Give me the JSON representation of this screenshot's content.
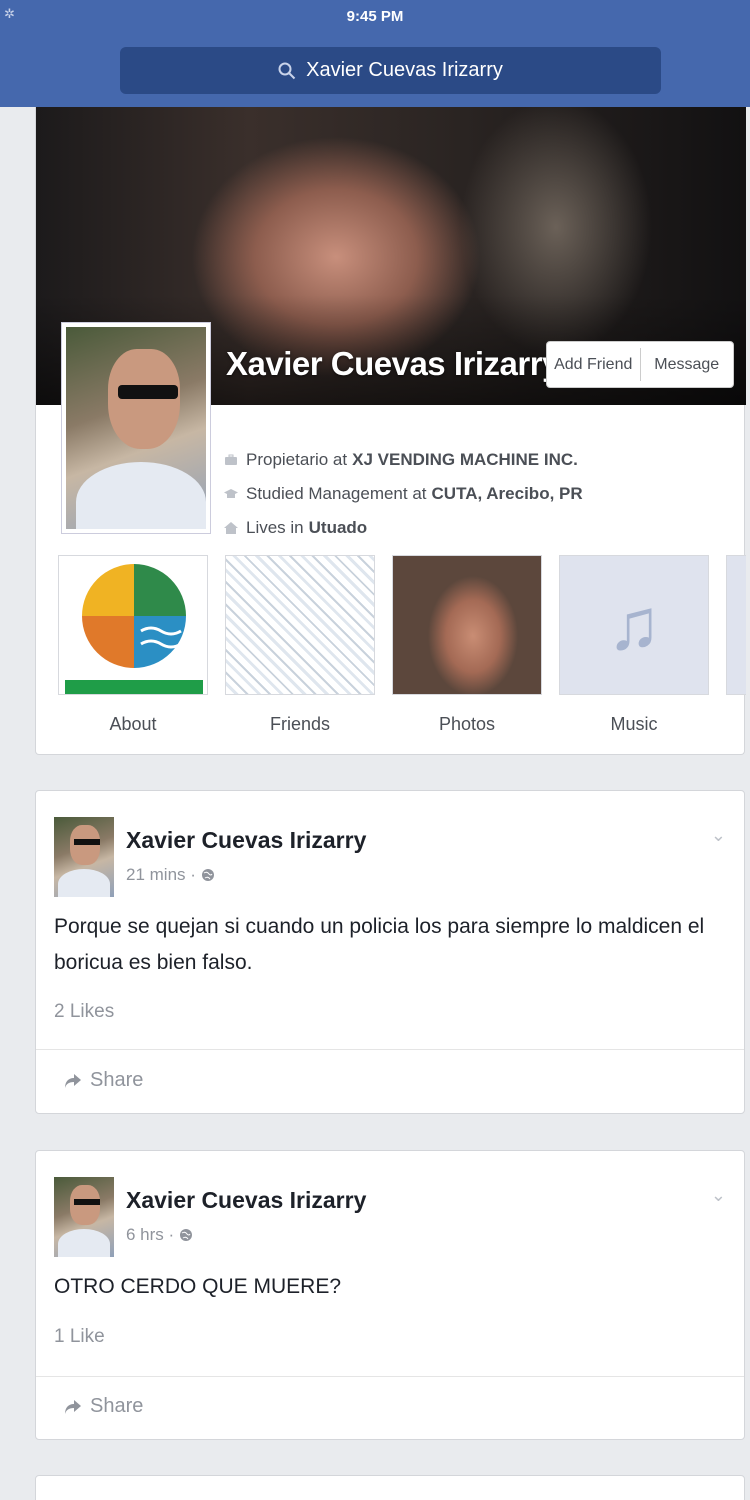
{
  "status_bar": {
    "time": "9:45 PM"
  },
  "search": {
    "query": "Xavier Cuevas Irizarry"
  },
  "profile": {
    "name": "Xavier Cuevas Irizarry",
    "actions": {
      "add_friend": "Add Friend",
      "message": "Message"
    },
    "info": [
      {
        "prefix": "Propietario at",
        "value": "XJ VENDING MACHINE INC.",
        "icon": "briefcase-icon"
      },
      {
        "prefix": "Studied Management at",
        "value": "CUTA, Arecibo, PR",
        "icon": "graduation-cap-icon"
      },
      {
        "prefix": "Lives in",
        "value": "Utuado",
        "icon": "home-icon"
      }
    ],
    "tiles": [
      {
        "label": "About"
      },
      {
        "label": "Friends"
      },
      {
        "label": "Photos"
      },
      {
        "label": "Music"
      }
    ]
  },
  "posts": [
    {
      "author": "Xavier Cuevas Irizarry",
      "time": "21 mins",
      "text": "Porque se quejan si cuando un policia los para siempre lo maldicen el boricua es bien falso.",
      "likes": "2 Likes",
      "share": "Share"
    },
    {
      "author": "Xavier Cuevas Irizarry",
      "time": "6 hrs",
      "text": "OTRO CERDO QUE MUERE?",
      "likes": "1 Like",
      "share": "Share"
    }
  ],
  "colors": {
    "header": "#4568ad",
    "search_bg": "#2b4a86",
    "page_bg": "#e9ebee"
  }
}
